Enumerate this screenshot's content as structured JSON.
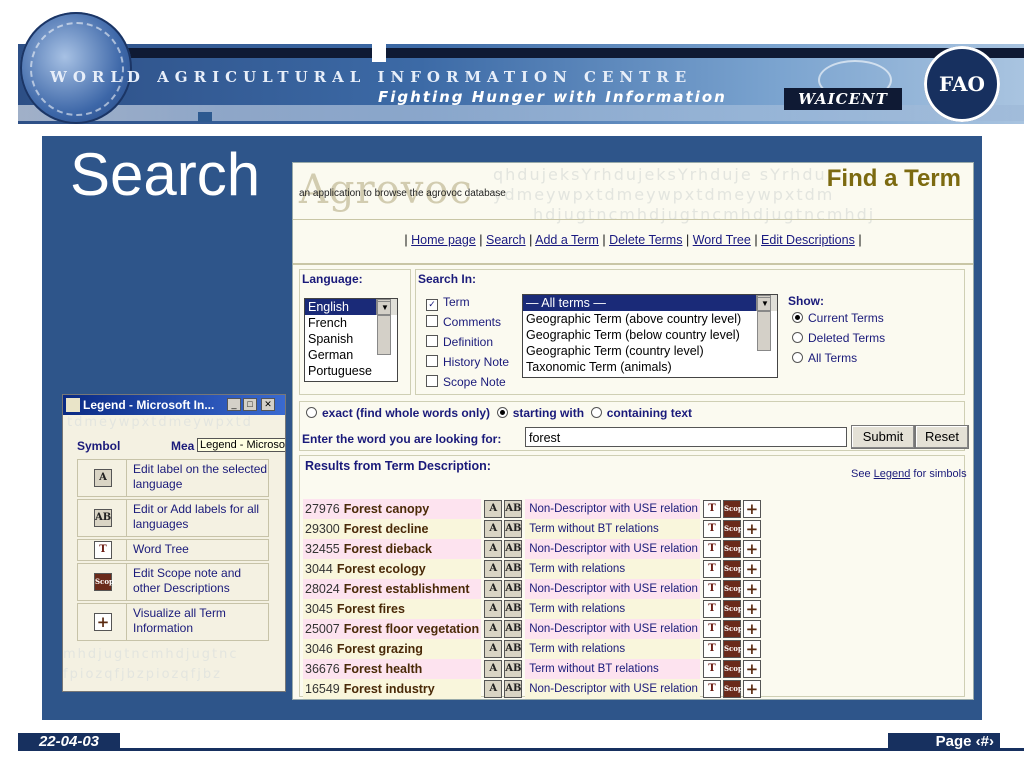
{
  "header": {
    "org_title": "WORLD AGRICULTURAL INFORMATION CENTRE",
    "org_subtitle": "Fighting Hunger with Information",
    "waicent_logo": "WAICENT",
    "fao_logo": "FAO"
  },
  "slide": {
    "title": "Search",
    "footer_date": "22-04-03",
    "footer_page": "Page ‹#›"
  },
  "app": {
    "logo_text": "Agrovoc",
    "logo_subtitle": "an application to browse the agrovoc database",
    "page_heading": "Find a Term",
    "nav": [
      "Home page",
      "Search",
      "Add a Term",
      "Delete Terms",
      "Word Tree",
      "Edit Descriptions"
    ],
    "nav_separator": "|",
    "language_label": "Language:",
    "languages": [
      "English",
      "French",
      "Spanish",
      "German",
      "Portuguese"
    ],
    "selected_language": "English",
    "search_in_label": "Search In:",
    "search_in_options": [
      {
        "label": "Term",
        "checked": true
      },
      {
        "label": "Comments",
        "checked": false
      },
      {
        "label": "Definition",
        "checked": false
      },
      {
        "label": "History Note",
        "checked": false
      },
      {
        "label": "Scope Note",
        "checked": false
      }
    ],
    "term_types": [
      "— All terms —",
      "Geographic Term (above country level)",
      "Geographic Term (below country level)",
      "Geographic Term (country level)",
      "Taxonomic Term (animals)"
    ],
    "show_label": "Show:",
    "show_options": [
      {
        "label": "Current Terms",
        "selected": true
      },
      {
        "label": "Deleted Terms",
        "selected": false
      },
      {
        "label": "All Terms",
        "selected": false
      }
    ],
    "match_options": [
      {
        "label": "exact (find whole words only)",
        "selected": false
      },
      {
        "label": "starting with",
        "selected": true
      },
      {
        "label": "containing text",
        "selected": false
      }
    ],
    "word_prompt": "Enter the word you are looking for:",
    "word_value": "forest",
    "submit_label": "Submit",
    "reset_label": "Reset",
    "results_title": "Results from Term Description:",
    "see_legend_prefix": "See",
    "see_legend_link": "Legend",
    "see_legend_suffix": "for simbols",
    "results": [
      {
        "id": "27976",
        "term": "Forest canopy",
        "relation": "Non-Descriptor with USE relation"
      },
      {
        "id": "29300",
        "term": "Forest decline",
        "relation": "Term without BT relations"
      },
      {
        "id": "32455",
        "term": "Forest dieback",
        "relation": "Non-Descriptor with USE relation"
      },
      {
        "id": "3044",
        "term": "Forest ecology",
        "relation": "Term with relations"
      },
      {
        "id": "28024",
        "term": "Forest establishment",
        "relation": "Non-Descriptor with USE relation"
      },
      {
        "id": "3045",
        "term": "Forest fires",
        "relation": "Term with relations"
      },
      {
        "id": "25007",
        "term": "Forest floor vegetation",
        "relation": "Non-Descriptor with USE relation"
      },
      {
        "id": "3046",
        "term": "Forest grazing",
        "relation": "Term with relations"
      },
      {
        "id": "36676",
        "term": "Forest health",
        "relation": "Term without BT relations"
      },
      {
        "id": "16549",
        "term": "Forest industry",
        "relation": "Non-Descriptor with USE relation"
      }
    ],
    "icons": {
      "edit_label": "A",
      "edit_all": "AB",
      "word_tree": "T",
      "scope": "Scop",
      "visualize": "+"
    }
  },
  "legend": {
    "window_title": "Legend - Microsoft In...",
    "tooltip": "Legend - Microso",
    "col_symbol": "Symbol",
    "col_meaning": "Mea",
    "items": [
      {
        "icon": "A",
        "text": "Edit label on the selected language"
      },
      {
        "icon": "AB",
        "text": "Edit or Add labels for all languages"
      },
      {
        "icon": "T",
        "text": "Word Tree"
      },
      {
        "icon": "Scop",
        "text": "Edit Scope note and other Descriptions"
      },
      {
        "icon": "+",
        "text": "Visualize all Term Information"
      }
    ]
  },
  "colors": {
    "slide_blue": "#2e558a",
    "header_dark": "#0f1a34",
    "heading_gold": "#7c6a10",
    "link_blue": "#1a1a80"
  }
}
